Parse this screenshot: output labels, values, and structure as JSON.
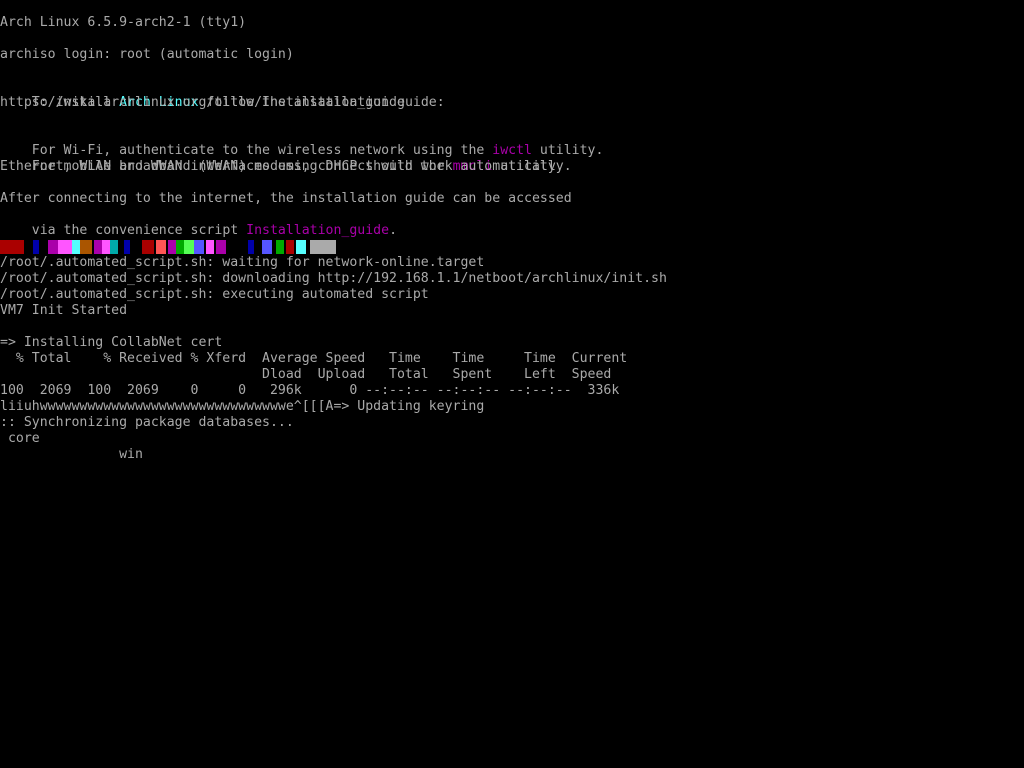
{
  "terminal": {
    "banner": "Arch Linux 6.5.9-arch2-1 (tty1)",
    "login": "archiso login: root (automatic login)",
    "install_prefix": "To install ",
    "install_highlight": "Arch Linux",
    "install_suffix": " follow the installation guide:",
    "guide_url": "https://wiki.archlinux.org/title/Installation_guide",
    "wifi_prefix": "For Wi-Fi, authenticate to the wireless network using the ",
    "wifi_tool": "iwctl",
    "wifi_suffix": " utility.",
    "wwan_prefix": "For mobile broadband (WWAN) modems, connect with the ",
    "wwan_tool": "mmcli",
    "wwan_suffix": " utility.",
    "dhcp_line": "Ethernet, WLAN and WWAN interfaces using DHCP should work automatically.",
    "after_line": "After connecting to the internet, the installation guide can be accessed",
    "script_prefix": "via the convenience script ",
    "script_name": "Installation_guide",
    "script_suffix": ".",
    "auto_wait": "/root/.automated_script.sh: waiting for network-online.target",
    "auto_download": "/root/.automated_script.sh: downloading http://192.168.1.1/netboot/archlinux/init.sh",
    "auto_exec": "/root/.automated_script.sh: executing automated script",
    "init_started": "VM7 Init Started",
    "cert_install": "=> Installing CollabNet cert",
    "curl_header1": "  % Total    % Received % Xferd  Average Speed   Time    Time     Time  Current",
    "curl_header2": "                                 Dload  Upload   Total   Spent    Left  Speed",
    "curl_progress": "100  2069  100  2069    0     0   296k      0 --:--:-- --:--:-- --:--:--  336k",
    "keyring_line": "liiuhwwwwwwwwwwwwwwwwwwwwwwwwwwwwwwwe^[[[A=> Updating keyring",
    "sync_line": ":: Synchronizing package databases...",
    "repo_core": " core",
    "repo_win": "               win"
  },
  "colors": {
    "background": "#000000",
    "text": "#aaaaaa",
    "highlight_cyan": "#55ffff",
    "highlight_magenta": "#aa00aa"
  }
}
